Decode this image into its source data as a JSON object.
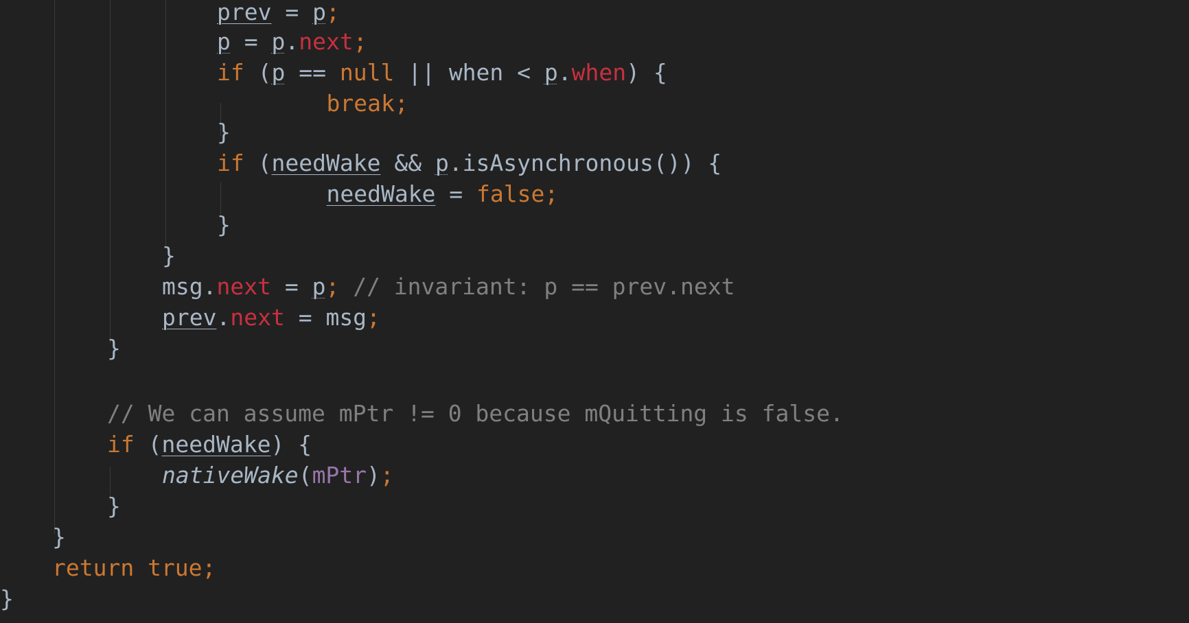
{
  "editor": {
    "language": "java",
    "colors": {
      "background": "#212121",
      "default_text": "#A9B7C6",
      "keyword": "#CC7832",
      "field": "#C8303F",
      "comment": "#808080",
      "instance_field": "#9876AA",
      "indent_guide": "#3A3A3A"
    },
    "lines": [
      {
        "indent": 0,
        "tokens": [
          {
            "t": "prev",
            "c": "ul"
          },
          {
            "t": " = "
          },
          {
            "t": "p",
            "c": "dul"
          },
          {
            "t": ";",
            "c": "kw"
          }
        ]
      },
      {
        "indent": 0,
        "tokens": [
          {
            "t": "p",
            "c": "dul"
          },
          {
            "t": " = "
          },
          {
            "t": "p",
            "c": "dul"
          },
          {
            "t": "."
          },
          {
            "t": "next",
            "c": "field"
          },
          {
            "t": ";",
            "c": "kw"
          }
        ]
      },
      {
        "indent": 0,
        "tokens": [
          {
            "t": "if",
            "c": "kw"
          },
          {
            "t": " ("
          },
          {
            "t": "p",
            "c": "dul"
          },
          {
            "t": " == "
          },
          {
            "t": "null",
            "c": "kw"
          },
          {
            "t": " || when < "
          },
          {
            "t": "p",
            "c": "dul"
          },
          {
            "t": "."
          },
          {
            "t": "when",
            "c": "field"
          },
          {
            "t": ") {"
          }
        ]
      },
      {
        "indent": 0,
        "tokens": [
          {
            "t": "    "
          },
          {
            "t": "break;",
            "c": "kw"
          }
        ]
      },
      {
        "indent": 0,
        "tokens": [
          {
            "t": "}"
          }
        ]
      },
      {
        "indent": 0,
        "tokens": [
          {
            "t": "if",
            "c": "kw"
          },
          {
            "t": " ("
          },
          {
            "t": "needWake",
            "c": "ul"
          },
          {
            "t": " && "
          },
          {
            "t": "p",
            "c": "dul"
          },
          {
            "t": ".isAsynchronous()) {"
          }
        ]
      },
      {
        "indent": 0,
        "tokens": [
          {
            "t": "    "
          },
          {
            "t": "needWake",
            "c": "ul"
          },
          {
            "t": " = "
          },
          {
            "t": "false;",
            "c": "kw"
          }
        ]
      },
      {
        "indent": 0,
        "tokens": [
          {
            "t": "}"
          }
        ]
      },
      {
        "indent": 0,
        "tokens": [
          {
            "t": "}"
          }
        ]
      },
      {
        "indent": 0,
        "tokens": [
          {
            "t": "msg."
          },
          {
            "t": "next",
            "c": "field"
          },
          {
            "t": " = "
          },
          {
            "t": "p",
            "c": "dul"
          },
          {
            "t": ";",
            "c": "kw"
          },
          {
            "t": " // invariant: p == prev.next",
            "c": "cmt"
          }
        ]
      },
      {
        "indent": 0,
        "tokens": [
          {
            "t": "prev",
            "c": "ul"
          },
          {
            "t": "."
          },
          {
            "t": "next",
            "c": "field"
          },
          {
            "t": " = msg"
          },
          {
            "t": ";",
            "c": "kw"
          }
        ]
      },
      {
        "indent": 0,
        "tokens": [
          {
            "t": "}"
          }
        ]
      },
      {
        "indent": 0,
        "tokens": []
      },
      {
        "indent": 0,
        "tokens": [
          {
            "t": "// We can assume mPtr != 0 because mQuitting is false.",
            "c": "cmt"
          }
        ]
      },
      {
        "indent": 0,
        "tokens": [
          {
            "t": "if",
            "c": "kw"
          },
          {
            "t": " ("
          },
          {
            "t": "needWake",
            "c": "ul"
          },
          {
            "t": ") {"
          }
        ]
      },
      {
        "indent": 0,
        "tokens": [
          {
            "t": "nativeWake",
            "c": "fn"
          },
          {
            "t": "("
          },
          {
            "t": "mPtr",
            "c": "inst"
          },
          {
            "t": ")"
          },
          {
            "t": ";",
            "c": "kw"
          }
        ]
      },
      {
        "indent": 0,
        "tokens": [
          {
            "t": "}"
          }
        ]
      },
      {
        "indent": 0,
        "tokens": [
          {
            "t": "}"
          }
        ]
      },
      {
        "indent": 0,
        "tokens": [
          {
            "t": "return true;",
            "c": "kw"
          }
        ]
      },
      {
        "indent": 0,
        "tokens": [
          {
            "t": "}"
          }
        ]
      }
    ]
  }
}
